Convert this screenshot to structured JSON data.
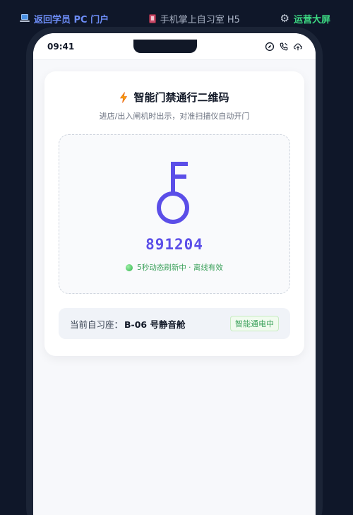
{
  "nav": {
    "pc_portal": "返回学员 PC 门户",
    "h5_label": "手机掌上自习室 H5",
    "ops_screen": "运营大屏"
  },
  "status_bar": {
    "time": "09:41"
  },
  "access_card": {
    "title": "智能门禁通行二维码",
    "subtitle": "进店/出入闸机时出示，对准扫描仪自动开门",
    "code": "891204",
    "refresh_text": "5秒动态刷新中 · 离线有效"
  },
  "seat": {
    "label": "当前自习座：",
    "value": "B-06 号静音舱",
    "badge": "智能通电中"
  },
  "colors": {
    "accent": "#5b4ee8",
    "nav_pc": "#6c8cf5",
    "nav_ops": "#3ddc84",
    "success": "#3aa05a",
    "background": "#0f1729"
  },
  "icons": {
    "pc": "laptop-icon",
    "h5": "mobile-phone-icon",
    "ops": "gear-icon",
    "title": "lightning-bolt-icon",
    "code": "key-icon",
    "status": [
      "compass-icon",
      "phone-call-icon",
      "cloud-upload-icon"
    ]
  }
}
